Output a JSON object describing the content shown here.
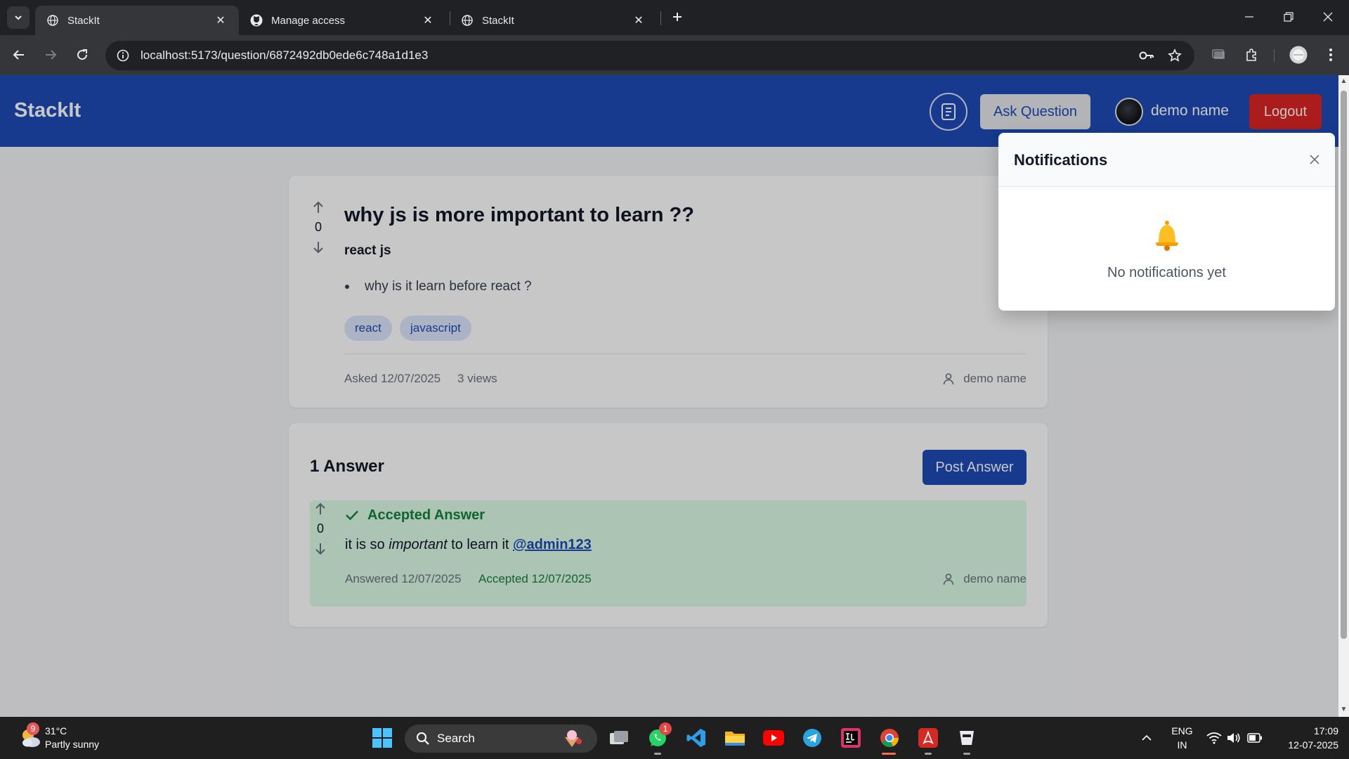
{
  "browser": {
    "tabs": [
      {
        "title": "StackIt",
        "icon": "globe-icon",
        "active": true
      },
      {
        "title": "Manage access",
        "icon": "github-icon",
        "active": false
      },
      {
        "title": "StackIt",
        "icon": "globe-icon",
        "active": false
      }
    ],
    "url": "localhost:5173/question/6872492db0ede6c748a1d1e3"
  },
  "header": {
    "brand": "StackIt",
    "ask_button": "Ask Question",
    "user_name": "demo name",
    "logout_button": "Logout"
  },
  "question": {
    "votes": "0",
    "title": "why js is more important to learn ??",
    "subheading": "react js",
    "bullet": "why is it learn before react ?",
    "tags": [
      "react",
      "javascript"
    ],
    "asked": "Asked 12/07/2025",
    "views": "3 views",
    "author": "demo name"
  },
  "answers": {
    "count_label": "1 Answer",
    "post_button": "Post Answer",
    "items": [
      {
        "accepted_label": "Accepted Answer",
        "votes": "0",
        "text_before": "it is so ",
        "text_emphasis": "important",
        "text_after": " to learn it ",
        "mention": "@admin123",
        "answered": "Answered 12/07/2025",
        "accepted": "Accepted 12/07/2025",
        "author": "demo name"
      }
    ]
  },
  "notifications": {
    "title": "Notifications",
    "empty_text": "No notifications yet"
  },
  "taskbar": {
    "weather_temp": "31°C",
    "weather_desc": "Partly sunny",
    "weather_badge": "9",
    "search_label": "Search",
    "whatsapp_badge": "1",
    "lang_top": "ENG",
    "lang_bottom": "IN",
    "time": "17:09",
    "date": "12-07-2025"
  },
  "colors": {
    "header_blue": "#1e4bb8",
    "logout_red": "#dc2626",
    "accepted_green": "#15803d",
    "accepted_bg": "#dcfce7",
    "tag_bg": "#dbe6fb"
  }
}
